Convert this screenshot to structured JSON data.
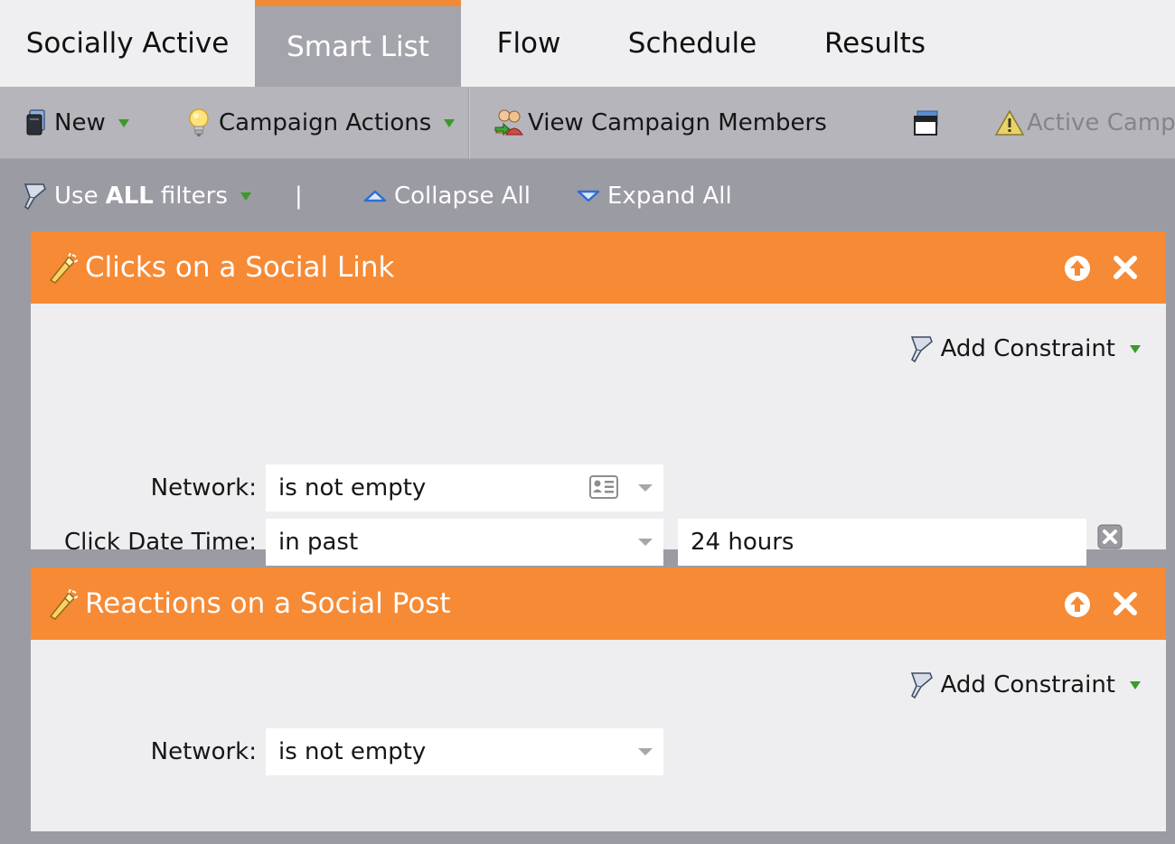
{
  "tabs": [
    {
      "label": "Socially Active"
    },
    {
      "label": "Smart List",
      "active": true
    },
    {
      "label": "Flow"
    },
    {
      "label": "Schedule"
    },
    {
      "label": "Results"
    }
  ],
  "toolbar": {
    "new_label": "New",
    "campaign_actions_label": "Campaign Actions",
    "view_members_label": "View Campaign Members",
    "active_campaign_label": "Active Campa"
  },
  "filter_bar": {
    "use_label": "Use",
    "all_label": "ALL",
    "filters_label": "filters",
    "divider": "|",
    "collapse_all_label": "Collapse All",
    "expand_all_label": "Expand All"
  },
  "filters": [
    {
      "title": "Clicks on a Social Link",
      "add_constraint_label": "Add Constraint",
      "rows": [
        {
          "label": "Network:",
          "operator": "is not empty"
        },
        {
          "label": "Click Date Time:",
          "operator": "in past",
          "value": "24 hours"
        }
      ]
    },
    {
      "title": "Reactions on a Social Post",
      "add_constraint_label": "Add Constraint",
      "rows": [
        {
          "label": "Network:",
          "operator": "is not empty"
        }
      ]
    }
  ],
  "colors": {
    "accent_orange": "#f68a35",
    "tab_active_bg": "#a4a4ac",
    "toolbar_bg": "#b5b5bb",
    "workspace_bg": "#9b9ba3",
    "panel_body_bg": "#eeeef0",
    "dropdown_green": "#3a9a2a"
  },
  "icons": [
    "new-icon",
    "lightbulb-icon",
    "members-icon",
    "window-icon",
    "warning-icon",
    "funnel-icon",
    "collapse-icon",
    "expand-icon",
    "filter-wand-icon",
    "move-up-icon",
    "close-icon",
    "card-icon",
    "delete-box-icon"
  ]
}
